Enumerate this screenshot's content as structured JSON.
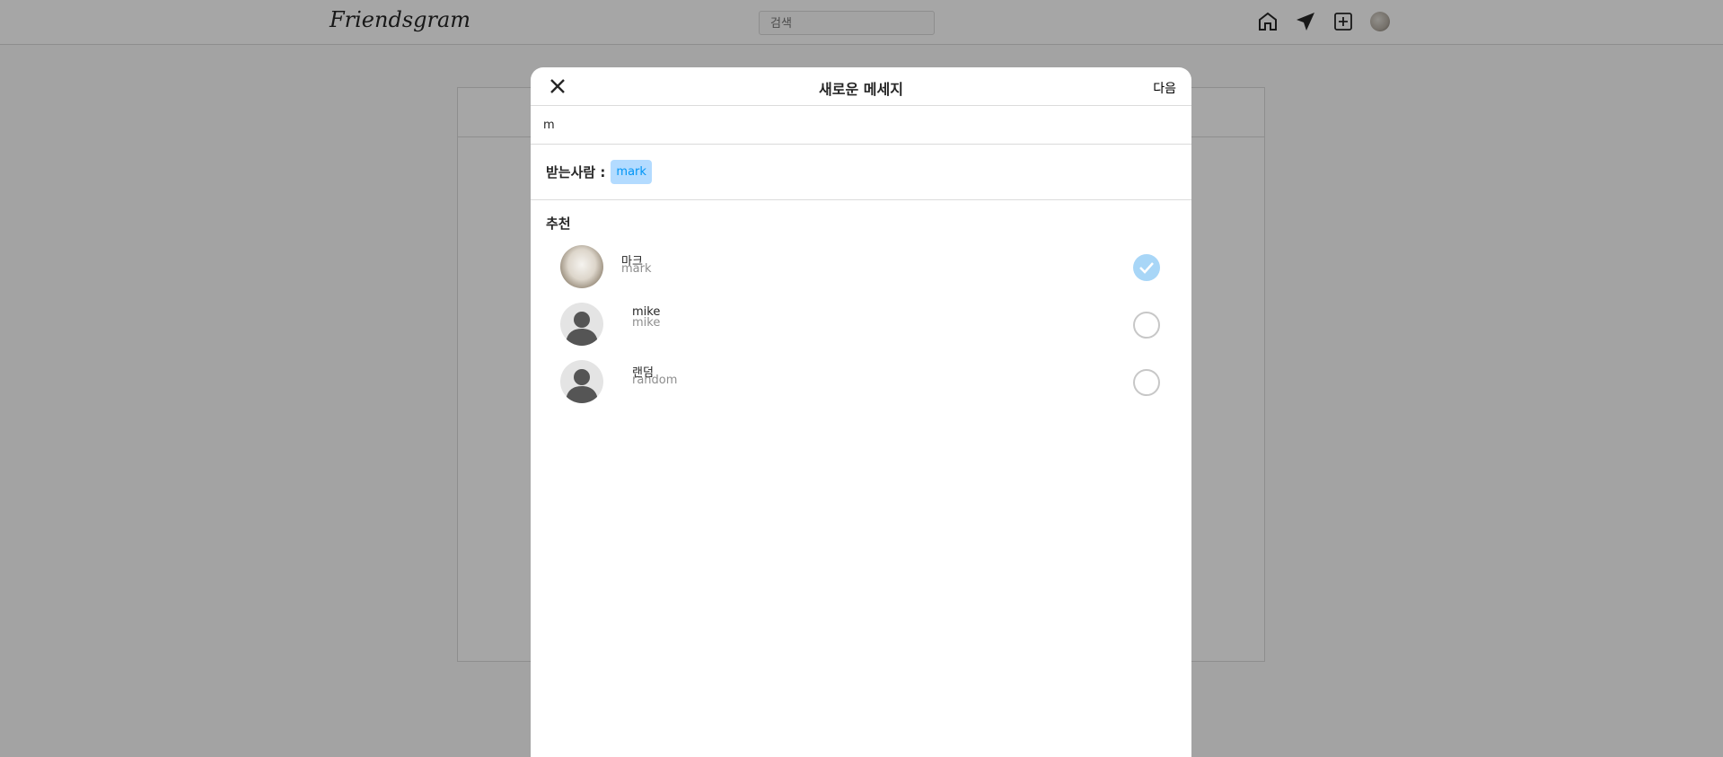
{
  "app": {
    "logo": "Friendsgram",
    "search_placeholder": "검색"
  },
  "modal": {
    "title": "새로운 메세지",
    "next_label": "다음",
    "search_value": "m",
    "recipient_label": "받는사람 :",
    "recipient_chip": "mark",
    "section_title": "추천",
    "users": [
      {
        "name": "마크",
        "username": "mark",
        "selected": true,
        "avatar": "photo"
      },
      {
        "name": "mike",
        "username": "mike",
        "selected": false,
        "avatar": "default"
      },
      {
        "name": "랜덤",
        "username": "random",
        "selected": false,
        "avatar": "default"
      }
    ]
  },
  "colors": {
    "accent": "#0095f6",
    "chip_bg": "#b3dbff",
    "check_on": "#a8d6f7"
  }
}
